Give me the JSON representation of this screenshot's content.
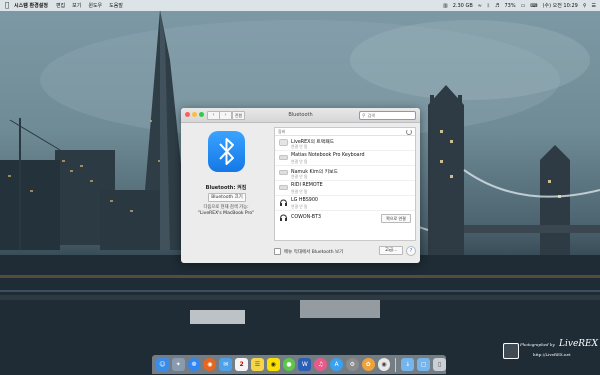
{
  "menubar": {
    "app_name": "시스템 환경설정",
    "items": [
      "편집",
      "보기",
      "윈도우",
      "도움말"
    ],
    "status": {
      "cpu_temp": "2.30 GB",
      "battery": "73%",
      "clock": "(수) 오전 10:29"
    }
  },
  "window": {
    "title": "Bluetooth",
    "grid_button_label": "전원",
    "search": {
      "placeholder": "검색",
      "value": ""
    },
    "left": {
      "status": "Bluetooth: 켜짐",
      "toggle_label": "Bluetooth 끄기",
      "discoverable_line": "다음으로 현재 검색 가능:",
      "discoverable_name": "\"LiveREX's MacBook Pro\""
    },
    "device_header": "장비",
    "devices": [
      {
        "name": "LiveREX의 트랙패드",
        "status": "연결 안 됨",
        "icon": "trackpad-icon",
        "connect": ""
      },
      {
        "name": "Matias Notebook Pro Keyboard",
        "status": "연결 안 됨",
        "icon": "keyboard-icon",
        "connect": ""
      },
      {
        "name": "Namuk Kim의 키보드",
        "status": "연결 안 됨",
        "icon": "keyboard-icon",
        "connect": ""
      },
      {
        "name": "RIDI REMOTE",
        "status": "연결 안 됨",
        "icon": "keyboard-icon",
        "connect": ""
      },
      {
        "name": "LG HBS900",
        "status": "연결 안 됨",
        "icon": "headphones-icon",
        "connect": ""
      },
      {
        "name": "COWON-BT3",
        "status": "",
        "icon": "headphones-icon",
        "connect": "짝으로 연결"
      }
    ],
    "menu_bar_checkbox": "메뉴 막대에서 Bluetooth 보기",
    "advanced_button": "고급...",
    "help_button": "?"
  },
  "dock": {
    "apps": [
      {
        "icon": "finder-icon",
        "color": "#3b8ce8"
      },
      {
        "icon": "launchpad-icon",
        "color": "#8a9bb0"
      },
      {
        "icon": "safari-icon",
        "color": "#2f86f5"
      },
      {
        "icon": "firefox-icon",
        "color": "#e6661f"
      },
      {
        "icon": "mail-icon",
        "color": "#4da0ea"
      },
      {
        "icon": "calendar-icon",
        "color": "#f4f4f4"
      },
      {
        "icon": "notes-icon",
        "color": "#f5d64a"
      },
      {
        "icon": "kakaotalk-icon",
        "color": "#f9e000"
      },
      {
        "icon": "messages-icon",
        "color": "#5cc84a"
      },
      {
        "icon": "word-icon",
        "color": "#2b5eb5"
      },
      {
        "icon": "itunes-icon",
        "color": "#e65b8a"
      },
      {
        "icon": "app-store-icon",
        "color": "#3aa0f0"
      },
      {
        "icon": "system-prefs-icon",
        "color": "#8c8c8c"
      },
      {
        "icon": "photos-icon",
        "color": "#f0a23a"
      },
      {
        "icon": "chrome-icon",
        "color": "#e8e8e8"
      },
      {
        "icon": "downloads-folder-icon",
        "color": "#76b4ec"
      },
      {
        "icon": "documents-folder-icon",
        "color": "#76b4ec"
      },
      {
        "icon": "trash-icon",
        "color": "#c9cfd4"
      }
    ],
    "calendar_day": "2"
  },
  "watermark": {
    "line1": "Photographed by",
    "line2": "LiveREX",
    "line3": "http://LiveREX.net"
  }
}
